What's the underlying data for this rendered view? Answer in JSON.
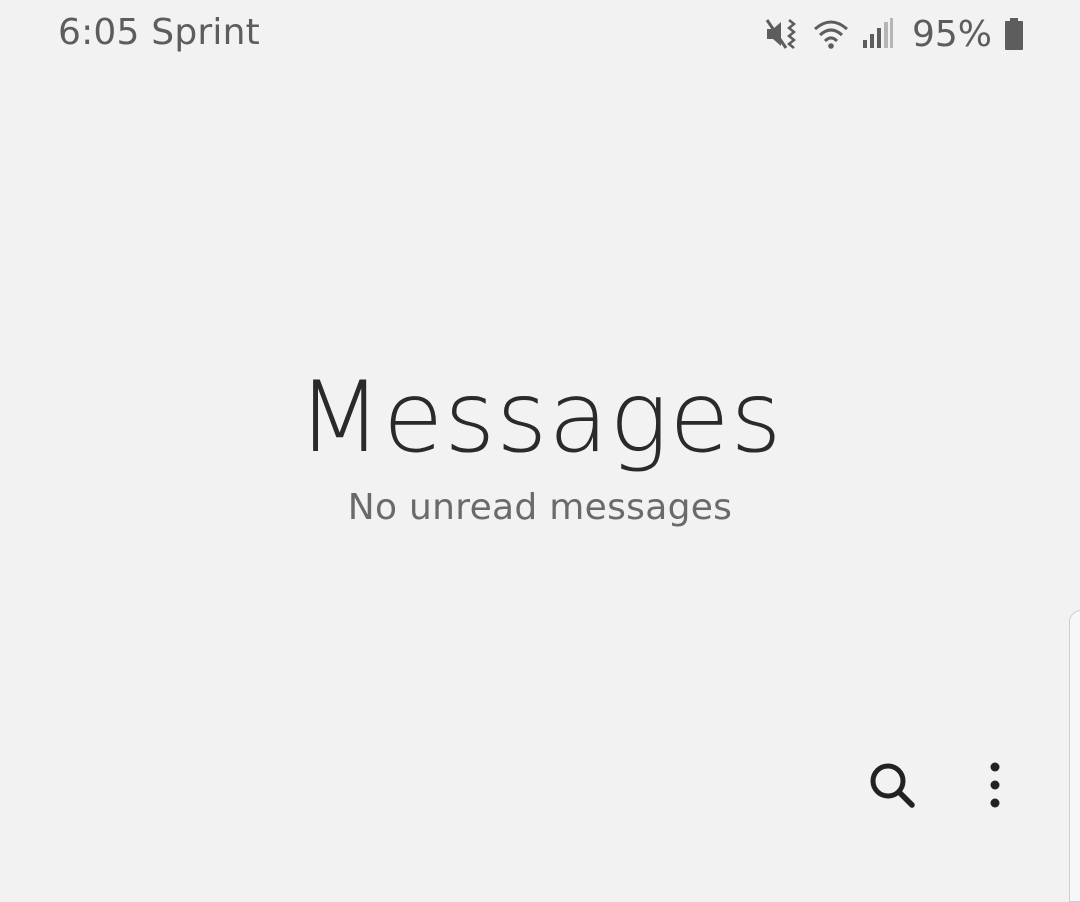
{
  "status_bar": {
    "time_carrier": "6:05 Sprint",
    "battery_percent": "95%",
    "icons": [
      "mute-vibrate-icon",
      "wifi-icon",
      "signal-icon",
      "battery-icon"
    ]
  },
  "header": {
    "title": "Messages",
    "subtitle": "No unread messages"
  },
  "toolbar": {
    "icons": [
      "search-icon",
      "more-options-icon"
    ]
  },
  "colors": {
    "background": "#f2f2f2",
    "title": "#2a2a2a",
    "subtitle": "#6a6a6a",
    "status_text": "#5d5d5d",
    "icon": "#222222"
  }
}
